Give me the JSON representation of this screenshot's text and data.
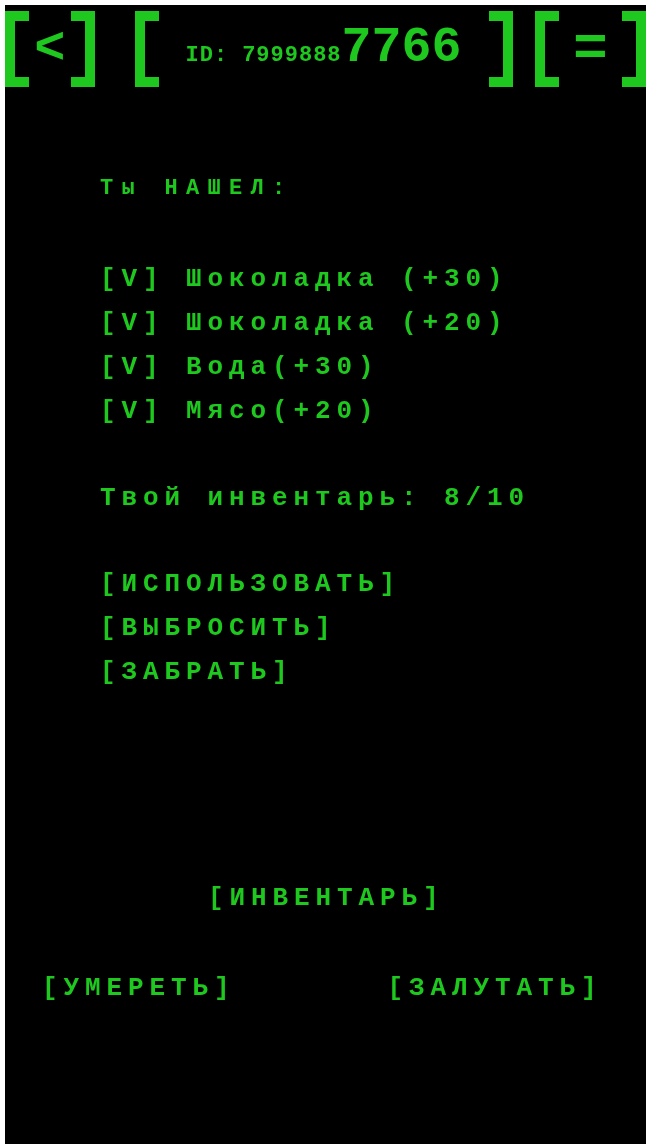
{
  "header": {
    "back": "<",
    "id_label": "ID:",
    "id_prefix": "7999888",
    "id_suffix": "7766",
    "menu": "="
  },
  "found_title": "Ты НАШЕЛ:",
  "found_items": [
    {
      "mark": "[V]",
      "label": "Шоколадка (+30)"
    },
    {
      "mark": "[V]",
      "label": "Шоколадка (+20)"
    },
    {
      "mark": "[V]",
      "label": "Вода(+30)"
    },
    {
      "mark": "[V]",
      "label": "Мясо(+20)"
    }
  ],
  "inventory_status": "Твой инвентарь: 8/10",
  "actions": [
    "[ИСПОЛЬЗОВАТЬ]",
    "[ВЫБРОСИТЬ]",
    "[ЗАБРАТЬ]"
  ],
  "inventory_button": "[ИНВЕНТАРЬ]",
  "bottom_buttons": [
    "[УМЕРЕТЬ]",
    "[ЗАЛУТАТЬ]"
  ]
}
